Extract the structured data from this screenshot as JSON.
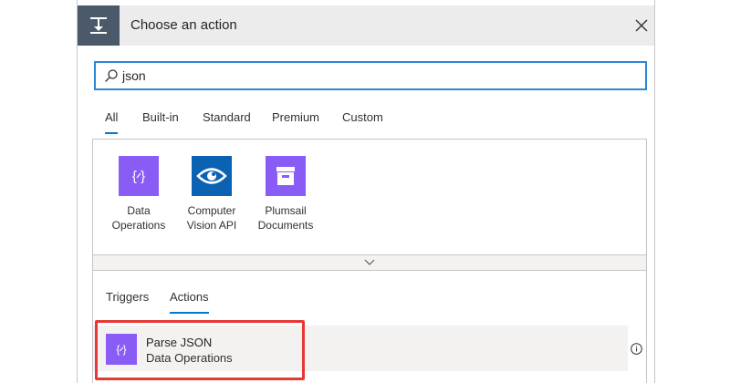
{
  "header": {
    "title": "Choose an action",
    "icon": "flow-step-icon",
    "close": "close-icon"
  },
  "search": {
    "value": "json",
    "placeholder": ""
  },
  "tabs": [
    {
      "label": "All",
      "active": true
    },
    {
      "label": "Built-in",
      "active": false
    },
    {
      "label": "Standard",
      "active": false
    },
    {
      "label": "Premium",
      "active": false
    },
    {
      "label": "Custom",
      "active": false
    }
  ],
  "connectors": [
    {
      "line1": "Data",
      "line2": "Operations",
      "color": "#8a5cf6",
      "icon": "data-operations-icon"
    },
    {
      "line1": "Computer",
      "line2": "Vision API",
      "color": "#0b62b3",
      "icon": "eye-icon"
    },
    {
      "line1": "Plumsail",
      "line2": "Documents",
      "color": "#8a5cf6",
      "icon": "file-cabinet-icon"
    }
  ],
  "expander": {
    "icon": "chevron-down-icon"
  },
  "subtabs": [
    {
      "label": "Triggers",
      "active": false
    },
    {
      "label": "Actions",
      "active": true
    }
  ],
  "action": {
    "title": "Parse JSON",
    "subtitle": "Data Operations",
    "color": "#8a5cf6",
    "icon": "data-operations-icon",
    "info_icon": "info-icon"
  },
  "colors": {
    "accent": "#0078d4",
    "highlight": "#e53935"
  }
}
